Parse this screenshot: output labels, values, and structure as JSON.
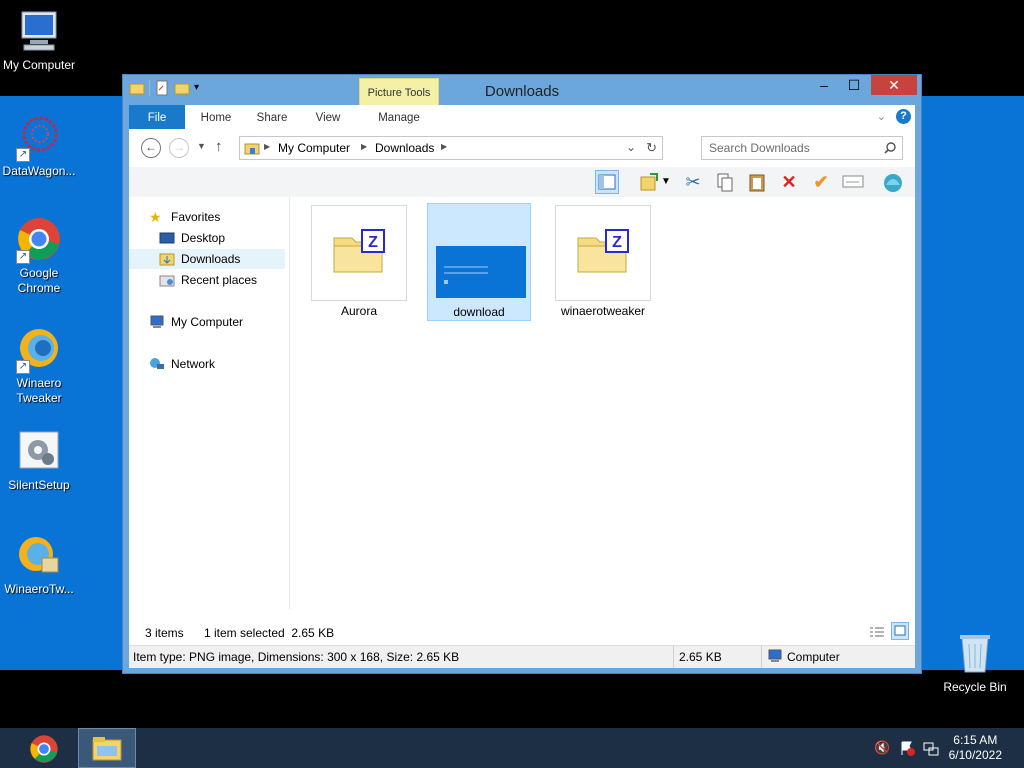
{
  "desktop": {
    "icons": [
      {
        "label": "My Computer"
      },
      {
        "label": "DataWagon..."
      },
      {
        "label": "Google Chrome"
      },
      {
        "label": "Winaero Tweaker"
      },
      {
        "label": "SilentSetup"
      },
      {
        "label": "WinaeroTw..."
      },
      {
        "label": "Recycle Bin"
      }
    ]
  },
  "window": {
    "title": "Downloads",
    "context_tab_group": "Picture Tools",
    "ribbon_tabs": [
      "File",
      "Home",
      "Share",
      "View",
      "Manage"
    ],
    "controls": {
      "minimize": "–",
      "maximize": "☐",
      "close": "✕"
    },
    "address": {
      "breadcrumbs": [
        "My Computer",
        "Downloads"
      ]
    },
    "search": {
      "placeholder": "Search Downloads"
    },
    "nav_pane": {
      "favorites_label": "Favorites",
      "favorites_items": [
        "Desktop",
        "Downloads",
        "Recent places"
      ],
      "computer_label": "My Computer",
      "network_label": "Network"
    },
    "files": [
      {
        "name": "Aurora",
        "icon": "winrar-folder-icon"
      },
      {
        "name": "download",
        "icon": "image-thumbnail",
        "selected": true
      },
      {
        "name": "winaerotweaker",
        "icon": "winrar-folder-icon"
      }
    ],
    "status": {
      "items_count": "3 items",
      "selection": "1 item selected  2.65 KB"
    },
    "details": {
      "item_info": "Item type: PNG image, Dimensions: 300 x 168, Size: 2.65 KB",
      "size": "2.65 KB",
      "location": "Computer"
    }
  },
  "taskbar": {
    "time": "6:15 AM",
    "date": "6/10/2022"
  },
  "colors": {
    "wallpaper": "#0a74d6",
    "window_frame": "#6ba6dc",
    "file_tab": "#1979ca",
    "taskbar": "#1c2f44",
    "selection": "#cce8ff"
  }
}
